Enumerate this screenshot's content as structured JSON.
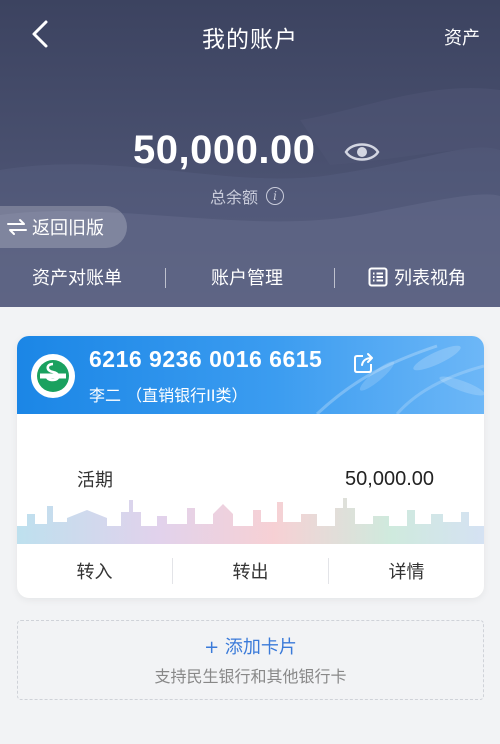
{
  "nav": {
    "title": "我的账户",
    "right_label": "资产"
  },
  "summary": {
    "balance": "50,000.00",
    "balance_label": "总余额"
  },
  "return_old": {
    "label": "返回旧版"
  },
  "tabs": [
    {
      "label": "资产对账单"
    },
    {
      "label": "账户管理"
    },
    {
      "label": "列表视角"
    }
  ],
  "card": {
    "number": "6216 9236 0016 6615",
    "owner": "李二 （直销银行II类）",
    "account_type": "活期",
    "amount": "50,000.00",
    "actions": [
      {
        "label": "转入"
      },
      {
        "label": "转出"
      },
      {
        "label": "详情"
      }
    ]
  },
  "add_card": {
    "title": "+ 添加卡片",
    "subtitle": "支持民生银行和其他银行卡"
  },
  "colors": {
    "header_bg": "#454c6b",
    "card_head": "#2a8fea",
    "link_blue": "#3a7ad9",
    "bank_logo_green": "#1aa15f"
  }
}
